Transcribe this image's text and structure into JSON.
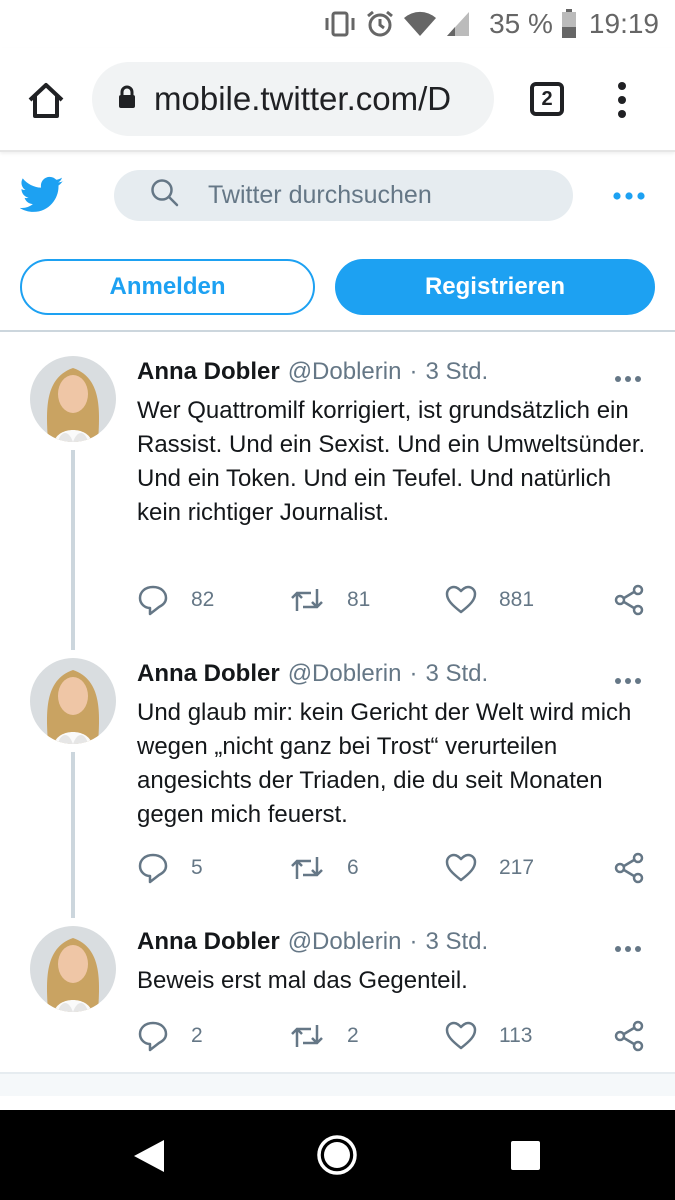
{
  "status_bar": {
    "battery": "35 %",
    "time": "19:19"
  },
  "browser": {
    "url": "mobile.twitter.com/D",
    "tab_count": "2"
  },
  "header": {
    "search_placeholder": "Twitter durchsuchen"
  },
  "auth": {
    "login_label": "Anmelden",
    "register_label": "Registrieren"
  },
  "tweets": [
    {
      "name": "Anna Dobler",
      "handle": "@Doblerin",
      "separator": "·",
      "time": "3 Std.",
      "text": "Wer Quattromilf korrigiert, ist grundsätzlich ein Rassist. Und ein Sexist. Und ein Umweltsünder. Und ein Token. Und ein Teufel. Und natürlich kein richtiger Journalist.",
      "replies": "82",
      "retweets": "81",
      "likes": "881"
    },
    {
      "name": "Anna Dobler",
      "handle": "@Doblerin",
      "separator": "·",
      "time": "3 Std.",
      "text": "Und glaub mir: kein Gericht der Welt wird mich wegen „nicht ganz bei Trost“ verurteilen  angesichts der Triaden, die du seit Monaten gegen mich feuerst.",
      "replies": "5",
      "retweets": "6",
      "likes": "217"
    },
    {
      "name": "Anna Dobler",
      "handle": "@Doblerin",
      "separator": "·",
      "time": "3 Std.",
      "text": "Beweis erst mal das Gegenteil.",
      "replies": "2",
      "retweets": "2",
      "likes": "113"
    }
  ],
  "colors": {
    "brand": "#1da1f2",
    "secondary_text": "#657786",
    "divider": "#ccd6dd"
  }
}
